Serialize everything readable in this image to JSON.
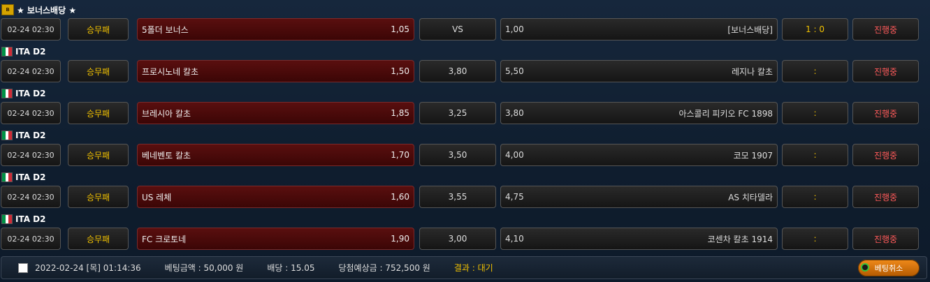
{
  "groups": [
    {
      "league": "★ 보너스배당 ★",
      "icon": "bonus-badge-icon",
      "match": {
        "time": "02-24 02:30",
        "type": "승무패",
        "home": "5폴더 보너스",
        "home_odds": "1,05",
        "draw": "VS",
        "away_odds": "1,00",
        "away": "[보너스배당]",
        "score": "1 : 0",
        "status": "진행중"
      }
    },
    {
      "league": "ITA D2",
      "icon": "italy-flag-icon",
      "match": {
        "time": "02-24 02:30",
        "type": "승무패",
        "home": "프로시노네 칼초",
        "home_odds": "1,50",
        "draw": "3,80",
        "away_odds": "5,50",
        "away": "레지나 칼초",
        "score": ":",
        "status": "진행중"
      }
    },
    {
      "league": "ITA D2",
      "icon": "italy-flag-icon",
      "match": {
        "time": "02-24 02:30",
        "type": "승무패",
        "home": "브레시아 칼초",
        "home_odds": "1,85",
        "draw": "3,25",
        "away_odds": "3,80",
        "away": "아스콜리 피키오 FC 1898",
        "score": ":",
        "status": "진행중"
      }
    },
    {
      "league": "ITA D2",
      "icon": "italy-flag-icon",
      "match": {
        "time": "02-24 02:30",
        "type": "승무패",
        "home": "베네벤토 칼초",
        "home_odds": "1,70",
        "draw": "3,50",
        "away_odds": "4,00",
        "away": "코모 1907",
        "score": ":",
        "status": "진행중"
      }
    },
    {
      "league": "ITA D2",
      "icon": "italy-flag-icon",
      "match": {
        "time": "02-24 02:30",
        "type": "승무패",
        "home": "US 레체",
        "home_odds": "1,60",
        "draw": "3,55",
        "away_odds": "4,75",
        "away": "AS 치타델라",
        "score": ":",
        "status": "진행중"
      }
    },
    {
      "league": "ITA D2",
      "icon": "italy-flag-icon",
      "match": {
        "time": "02-24 02:30",
        "type": "승무패",
        "home": "FC 크로토네",
        "home_odds": "1,90",
        "draw": "3,00",
        "away_odds": "4,10",
        "away": "코센차 칼초 1914",
        "score": ":",
        "status": "진행중"
      }
    }
  ],
  "footer": {
    "datetime": "2022-02-24 [목] 01:14:36",
    "bet_amount": "베팅금액 : 50,000 원",
    "odds": "배당 : 15.05",
    "expected": "당첨예상금 : 752,500 원",
    "result": "결과 : 대기",
    "cancel_label": "베팅취소"
  },
  "colors": {
    "accent_yellow": "#f2c200",
    "status_red": "#ff5a5a",
    "home_red": "#5a0f0f"
  }
}
